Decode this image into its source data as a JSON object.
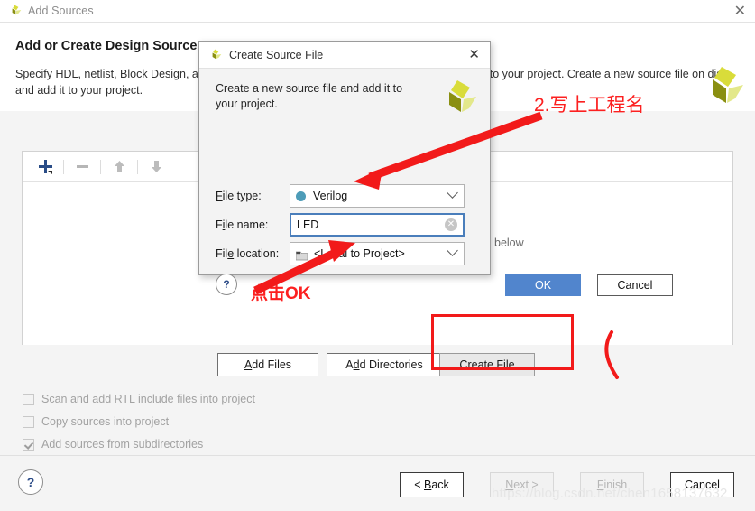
{
  "window": {
    "title": "Add Sources",
    "close_label": "✕",
    "heading": "Add or Create Design Sources",
    "description": "Specify HDL, netlist, Block Design, and IP files, or directories containing those file types to add to your project. Create a new source file on disk and add it to your project.",
    "logo_name": "vivado-logo"
  },
  "toolbar": {
    "add_icon": "plus-icon",
    "remove_icon": "minus-icon",
    "move_up_icon": "arrow-up-icon",
    "move_down_icon": "arrow-down-icon"
  },
  "actions": {
    "add_files": "Add Files",
    "add_files_mnemonic": "A",
    "add_directories": "Add Directories",
    "add_directories_mnemonic": "d",
    "create_file": "Create File",
    "create_file_mnemonic": "C"
  },
  "options": [
    {
      "label": "Scan and add RTL include files into project",
      "checked": false,
      "enabled": false
    },
    {
      "label": "Copy sources into project",
      "checked": false,
      "enabled": false
    },
    {
      "label": "Add sources from subdirectories",
      "checked": true,
      "enabled": false
    }
  ],
  "footer": {
    "help": "?",
    "back": "< Back",
    "next": "Next >",
    "finish": "Finish",
    "cancel": "Cancel"
  },
  "dialog": {
    "title": "Create Source File",
    "close_label": "✕",
    "intro": "Create a new source file and add it to your project.",
    "logo_name": "vivado-logo",
    "fields": {
      "file_type": {
        "label": "File type:",
        "value": "Verilog",
        "icon": "verilog-dot-icon"
      },
      "file_name": {
        "label": "File name:",
        "value": "LED",
        "placeholder": "",
        "clear_icon": "clear-icon"
      },
      "file_location": {
        "label": "File location:",
        "value": "<Local to Project>",
        "icon": "folder-icon"
      }
    },
    "help": "?",
    "ok": "OK",
    "cancel": "Cancel"
  },
  "annotations": {
    "project_name_note": "2.写上工程名",
    "click_ok_note": "点击OK",
    "highlight_color": "#f21a1a"
  },
  "watermark": "https://blog.csdn.net/chen1658137632",
  "colors": {
    "accent_blue": "#5185cd",
    "focus_blue": "#4a7ebb",
    "verilog_dot": "#4d9cb8",
    "annotation_red": "#f21a1a",
    "window_bg": "#f4f4f4"
  },
  "partial_text": {
    "below": "below"
  }
}
